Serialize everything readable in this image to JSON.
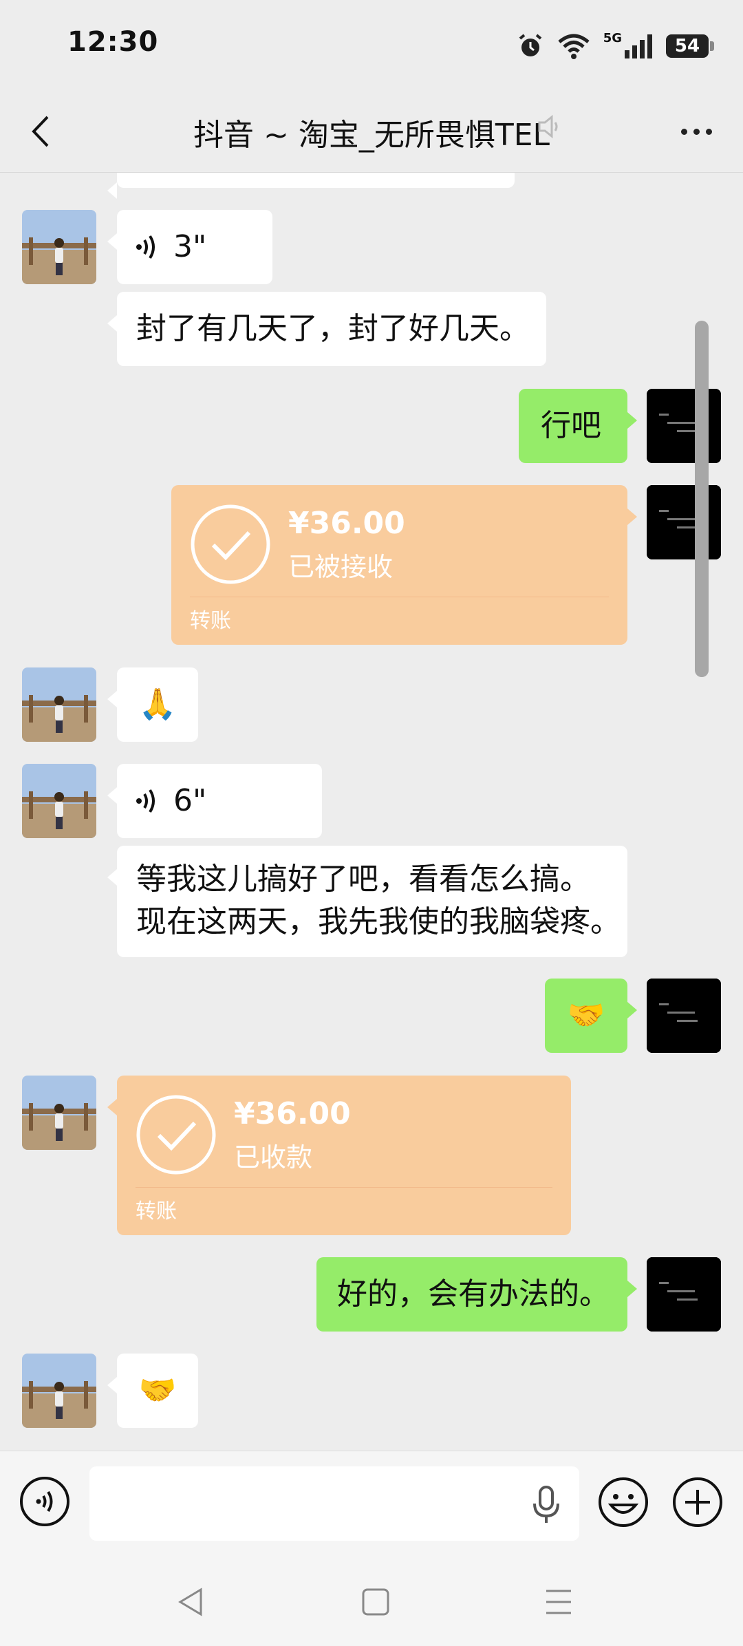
{
  "status_bar": {
    "time": "12:30",
    "network": "5G",
    "battery": "54"
  },
  "header": {
    "back_icon": "chevron-left-icon",
    "title": "抖音 ~ 淘宝_无所畏惧TEL",
    "speaker_icon": "speaker-muted-icon",
    "more_icon": "more-dots-icon"
  },
  "messages": [
    {
      "side": "left",
      "type": "voice",
      "duration": "3\""
    },
    {
      "side": "left",
      "type": "text",
      "text": "封了有几天了，封了好几天。"
    },
    {
      "side": "right",
      "type": "text",
      "text": "行吧"
    },
    {
      "side": "right",
      "type": "transfer",
      "amount": "¥36.00",
      "status": "已被接收",
      "label": "转账"
    },
    {
      "side": "left",
      "type": "emoji",
      "text": "🙏"
    },
    {
      "side": "left",
      "type": "voice",
      "duration": "6\""
    },
    {
      "side": "left",
      "type": "text",
      "text_lines": [
        "等我这儿搞好了吧，看看怎么搞。",
        "现在这两天，我先我使的我脑袋疼。"
      ]
    },
    {
      "side": "right",
      "type": "emoji",
      "text": "🤝"
    },
    {
      "side": "left",
      "type": "transfer",
      "amount": "¥36.00",
      "status": "已收款",
      "label": "转账"
    },
    {
      "side": "right",
      "type": "text",
      "text": "好的，会有办法的。"
    },
    {
      "side": "left",
      "type": "emoji",
      "text": "🤝"
    }
  ],
  "input_bar": {
    "placeholder": "",
    "voice_icon": "voice-toggle-icon",
    "mic_icon": "microphone-icon",
    "emoji_icon": "emoji-icon",
    "plus_icon": "plus-icon"
  },
  "colors": {
    "chat_bg": "#ededed",
    "bubble_green": "#95ec69",
    "transfer_orange": "#f9cc9d"
  }
}
